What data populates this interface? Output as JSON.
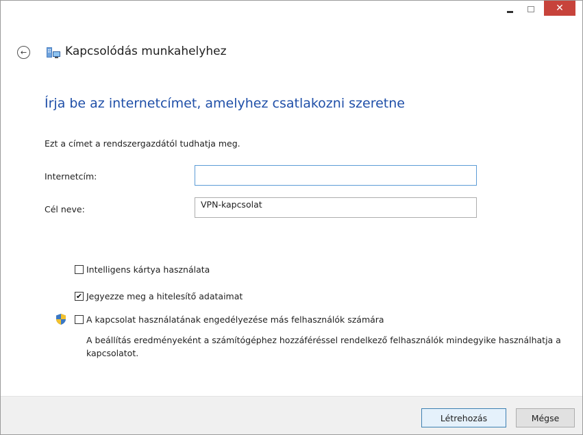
{
  "window": {
    "title": "Kapcsolódás munkahelyhez",
    "controls": {
      "minimize": "–",
      "maximize": "□",
      "close": "✕"
    },
    "accent_close": "#c7433b"
  },
  "header": {
    "back_icon": "back-arrow-icon",
    "app_icon": "workplace-network-icon",
    "title": "Kapcsolódás munkahelyhez"
  },
  "main": {
    "heading": "Írja be az internetcímet, amelyhez csatlakozni szeretne",
    "heading_color": "#1f4fa8",
    "hint": "Ezt a címet a rendszergazdától tudhatja meg.",
    "internet_address": {
      "label": "Internetcím:",
      "value": ""
    },
    "destination_name": {
      "label": "Cél neve:",
      "value": "VPN-kapcsolat"
    },
    "options": [
      {
        "label": "Intelligens kártya használata",
        "checked": false
      },
      {
        "label": "Jegyezze meg a hitelesítő adataimat",
        "checked": true
      },
      {
        "label": "A kapcsolat használatának engedélyezése más felhasználók számára",
        "checked": false,
        "icon": "uac-shield-icon"
      }
    ],
    "allow_description": "A beállítás eredményeként a számítógéphez hozzáféréssel rendelkező felhasználók mindegyike használhatja a kapcsolatot."
  },
  "footer": {
    "create_button": "Létrehozás",
    "cancel_button": "Mégse"
  }
}
